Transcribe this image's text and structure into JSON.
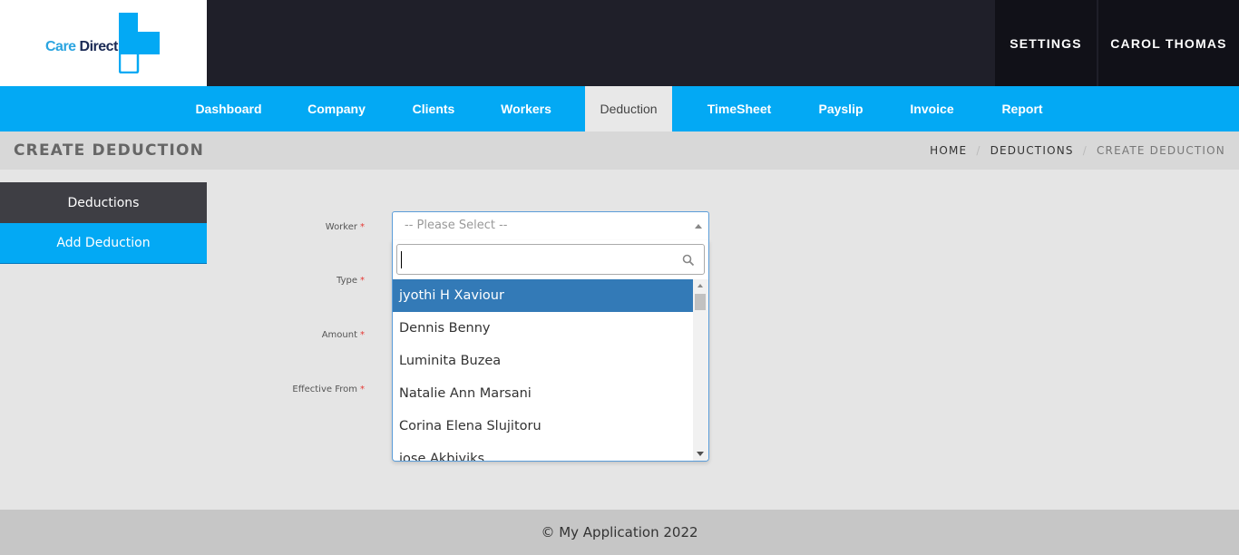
{
  "brand": {
    "logo_part1": "Care ",
    "logo_part2": "Direct",
    "accent": "#03a9f4"
  },
  "header": {
    "settings_label": "SETTINGS",
    "user_label": "CAROL THOMAS"
  },
  "nav": {
    "items": [
      {
        "label": "Dashboard"
      },
      {
        "label": "Company"
      },
      {
        "label": "Clients"
      },
      {
        "label": "Workers"
      },
      {
        "label": "Deduction",
        "active": true
      },
      {
        "label": "TimeSheet"
      },
      {
        "label": "Payslip"
      },
      {
        "label": "Invoice"
      },
      {
        "label": "Report"
      }
    ]
  },
  "page": {
    "title": "CREATE DEDUCTION",
    "breadcrumb": [
      "HOME",
      "DEDUCTIONS",
      "CREATE DEDUCTION"
    ],
    "breadcrumb_separator": "/"
  },
  "sidebar": {
    "items": [
      {
        "label": "Deductions"
      },
      {
        "label": "Add Deduction",
        "active": true
      }
    ]
  },
  "form": {
    "required_marker": "*",
    "labels": {
      "worker": "Worker",
      "type": "Type",
      "amount": "Amount",
      "effective_from": "Effective From"
    },
    "worker_select": {
      "placeholder": "-- Please Select --",
      "search_value": "",
      "options": [
        "jyothi H Xaviour",
        "Dennis Benny",
        "Luminita Buzea",
        "Natalie Ann Marsani",
        "Corina Elena Slujitoru",
        "jose Akbiyiks"
      ],
      "highlighted": "jyothi H Xaviour"
    }
  },
  "footer": {
    "text": "© My Application 2022"
  }
}
